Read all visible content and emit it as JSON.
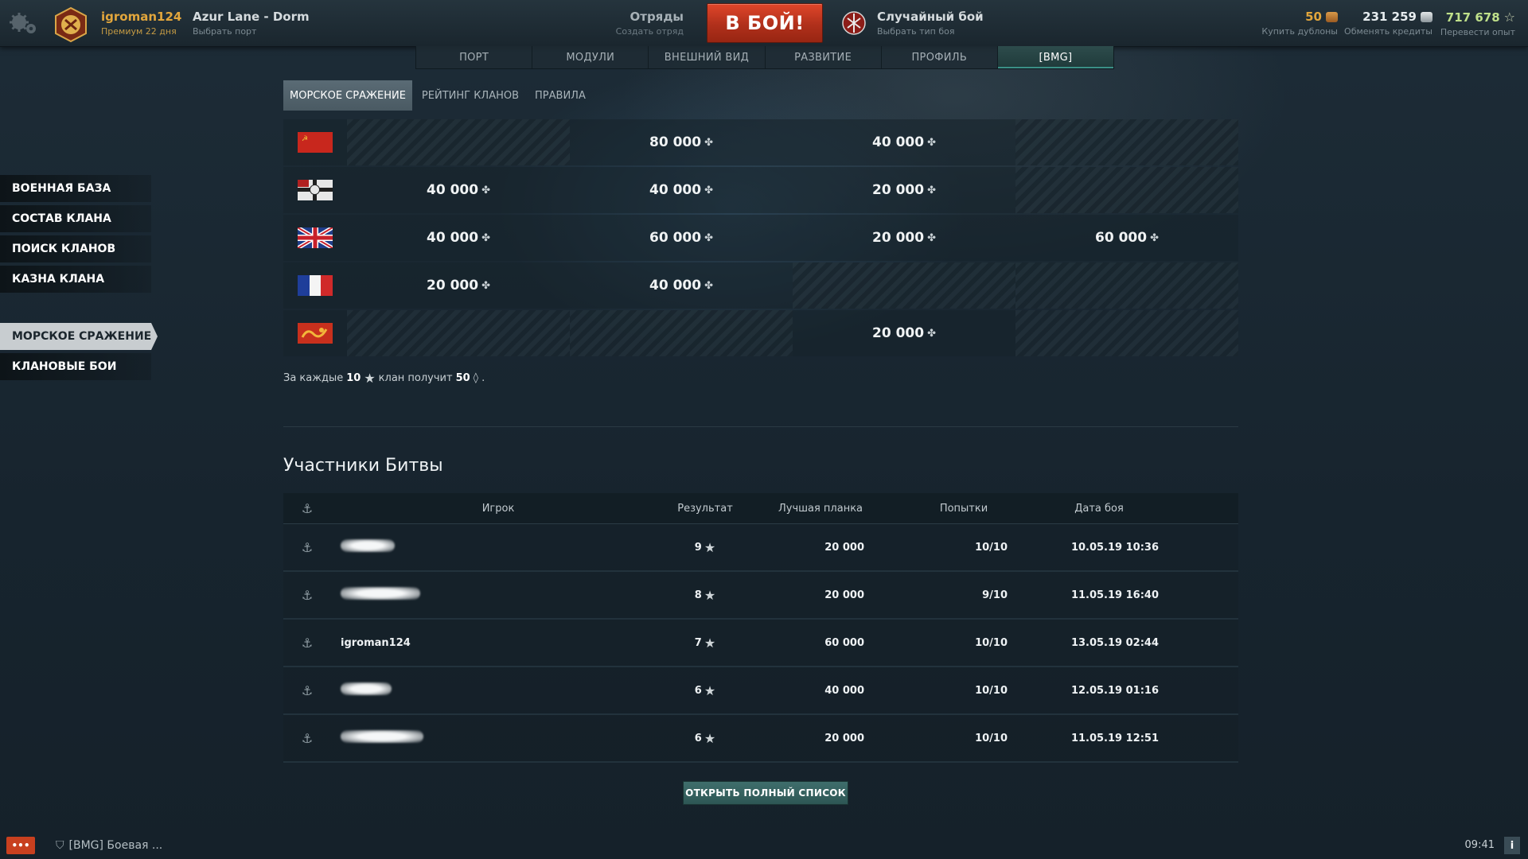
{
  "topbar": {
    "user": {
      "name": "igroman124",
      "sub": "Премиум 22 дня"
    },
    "port": {
      "name": "Azur Lane - Dorm",
      "sub": "Выбрать порт"
    },
    "squad": {
      "title": "Отряды",
      "sub": "Создать отряд"
    },
    "battle_label": "В БОЙ!",
    "mode": {
      "title": "Случайный бой",
      "sub": "Выбрать тип боя"
    },
    "currencies": [
      {
        "value": "50",
        "sub": "Купить дублоны",
        "color": "#e2a63c",
        "icon": "doubloon-icon"
      },
      {
        "value": "231 259",
        "sub": "Обменять кредиты",
        "color": "#e6ecef",
        "icon": "credits-icon"
      },
      {
        "value": "717 678",
        "sub": "Перевести опыт",
        "color": "#bfe08a",
        "icon": "free-xp-icon"
      }
    ]
  },
  "mainnav": {
    "tabs": [
      "ПОРТ",
      "МОДУЛИ",
      "ВНЕШНИЙ ВИД",
      "РАЗВИТИЕ",
      "ПРОФИЛЬ",
      "[BMG]"
    ],
    "active": "[BMG]"
  },
  "sidebar": {
    "group1": [
      "ВОЕННАЯ БАЗА",
      "СОСТАВ КЛАНА",
      "ПОИСК КЛАНОВ",
      "КАЗНА КЛАНА"
    ],
    "group2": [
      "МОРСКОЕ СРАЖЕНИЕ",
      "КЛАНОВЫЕ БОИ"
    ],
    "active": "МОРСКОЕ СРАЖЕНИЕ"
  },
  "subtabs": {
    "items": [
      "МОРСКОЕ СРАЖЕНИЕ",
      "РЕЙТИНГ КЛАНОВ",
      "ПРАВИЛА"
    ],
    "active": "МОРСКОЕ СРАЖЕНИЕ"
  },
  "rewards": {
    "rows": [
      {
        "flag": "ussr-flag",
        "cells": [
          "",
          "80 000",
          "40 000",
          ""
        ]
      },
      {
        "flag": "germany-flag",
        "cells": [
          "40 000",
          "40 000",
          "20 000",
          ""
        ]
      },
      {
        "flag": "uk-flag",
        "cells": [
          "40 000",
          "60 000",
          "20 000",
          "60 000"
        ]
      },
      {
        "flag": "france-flag",
        "cells": [
          "20 000",
          "40 000",
          "",
          ""
        ]
      },
      {
        "flag": "pan-asia-flag",
        "cells": [
          "",
          "",
          "20 000",
          ""
        ]
      }
    ]
  },
  "note": {
    "prefix": "За каждые",
    "stars": "10",
    "middle": "клан получит",
    "amount": "50",
    "suffix": "."
  },
  "participants": {
    "title": "Участники Битвы",
    "headers": {
      "player": "Игрок",
      "result": "Результат",
      "best": "Лучшая планка",
      "tries": "Попытки",
      "date": "Дата боя"
    },
    "rows": [
      {
        "player": "",
        "hidden_width": 68,
        "result": "9",
        "best": "20 000",
        "tries": "10/10",
        "date": "10.05.19 10:36"
      },
      {
        "player": "",
        "hidden_width": 100,
        "result": "8",
        "best": "20 000",
        "tries": "9/10",
        "date": "11.05.19 16:40"
      },
      {
        "player": "igroman124",
        "hidden_width": 0,
        "result": "7",
        "best": "60 000",
        "tries": "10/10",
        "date": "13.05.19 02:44"
      },
      {
        "player": "",
        "hidden_width": 64,
        "result": "6",
        "best": "40 000",
        "tries": "10/10",
        "date": "12.05.19 01:16"
      },
      {
        "player": "",
        "hidden_width": 104,
        "result": "6",
        "best": "20 000",
        "tries": "10/10",
        "date": "11.05.19 12:51"
      }
    ],
    "open_label": "ОТКРЫТЬ ПОЛНЫЙ СПИСОК"
  },
  "bottombar": {
    "chat_label": "•••",
    "chat_text": "[BMG] Боевая ...",
    "clock": "09:41",
    "info_label": "i"
  }
}
